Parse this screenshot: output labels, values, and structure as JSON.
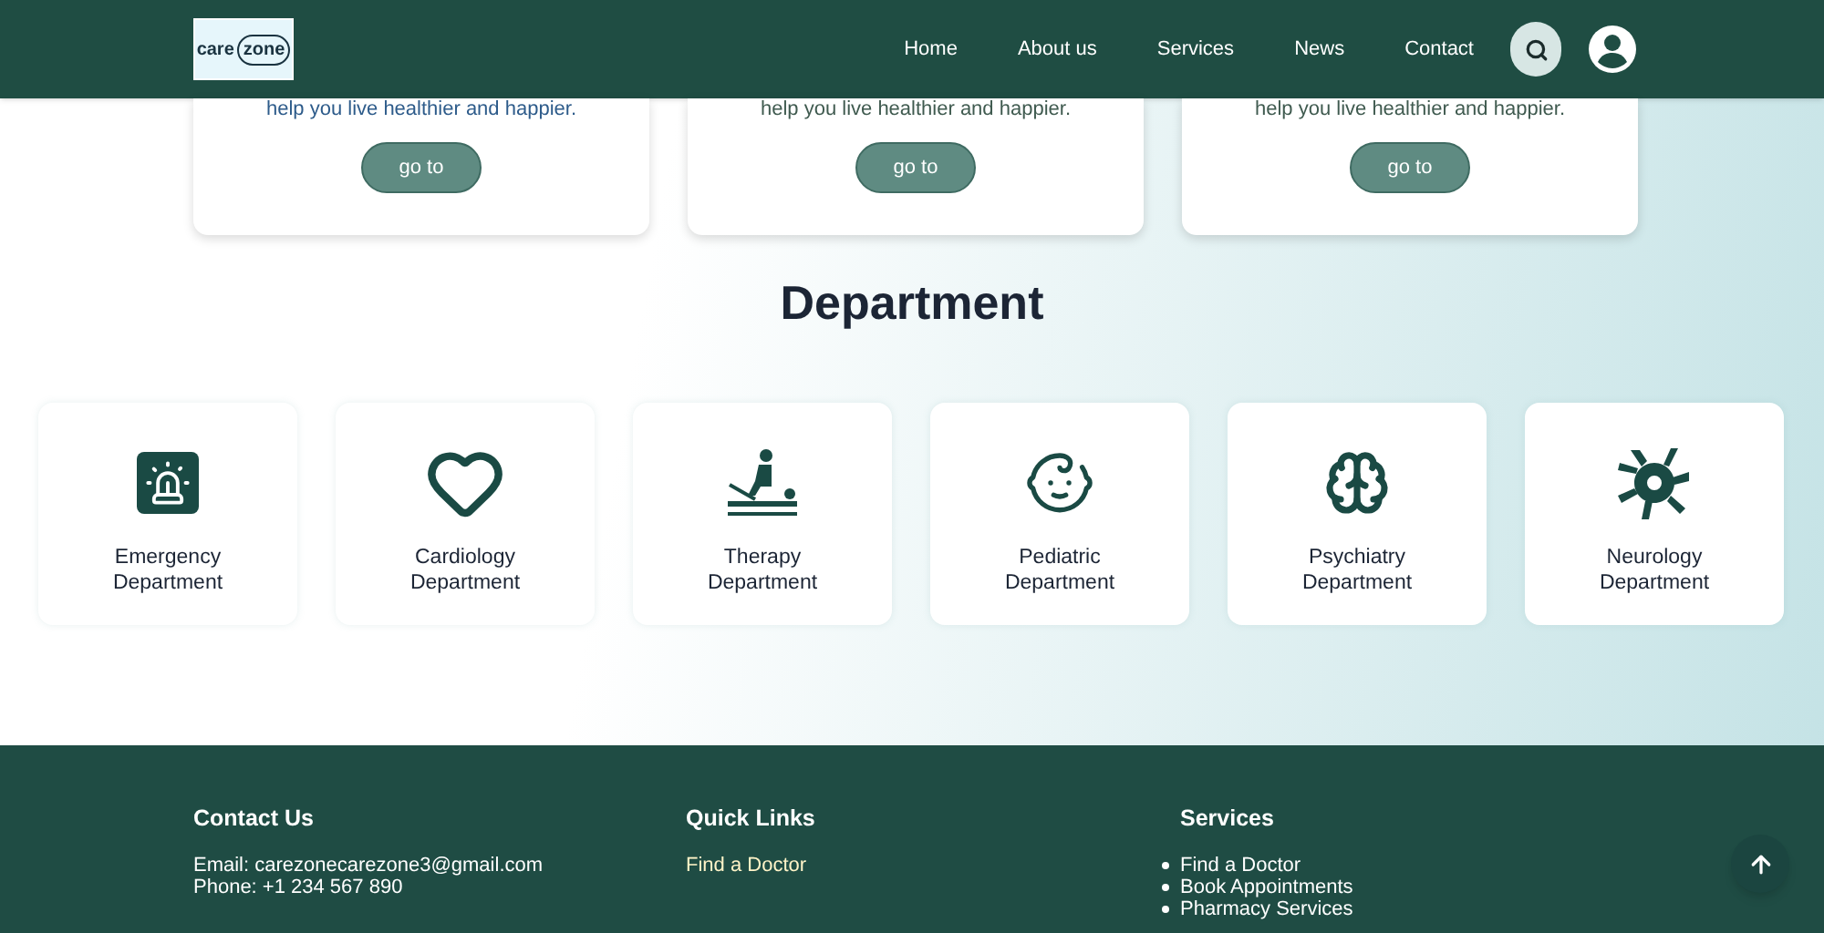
{
  "header": {
    "logo": {
      "word_1": "care",
      "word_2": "zone"
    },
    "nav": [
      {
        "label": "Home"
      },
      {
        "label": "About us"
      },
      {
        "label": "Services"
      },
      {
        "label": "News"
      },
      {
        "label": "Contact"
      }
    ]
  },
  "service_cards": [
    {
      "text": "help you live healthier and happier.",
      "button": "go to"
    },
    {
      "text": "help you live healthier and happier.",
      "button": "go to"
    },
    {
      "text": "help you live healthier and happier.",
      "button": "go to"
    }
  ],
  "department": {
    "title": "Department",
    "items": [
      {
        "kind": "siren",
        "line_1": "Emergency",
        "line_2": "Department"
      },
      {
        "kind": "heart",
        "line_1": "Cardiology",
        "line_2": "Department"
      },
      {
        "kind": "therapy",
        "line_1": "Therapy",
        "line_2": "Department"
      },
      {
        "kind": "baby",
        "line_1": "Pediatric",
        "line_2": "Department"
      },
      {
        "kind": "brain",
        "line_1": "Psychiatry",
        "line_2": "Department"
      },
      {
        "kind": "neuron",
        "line_1": "Neurology",
        "line_2": "Department"
      }
    ]
  },
  "footer": {
    "contact": {
      "title": "Contact Us",
      "email": "Email: carezonecarezone3@gmail.com",
      "phone": "Phone: +1 234 567 890"
    },
    "quick_links": {
      "title": "Quick Links",
      "links": [
        "Find a Doctor"
      ]
    },
    "services": {
      "title": "Services",
      "items": [
        "Find a Doctor",
        "Book Appointments",
        "Pharmacy Services"
      ]
    }
  }
}
